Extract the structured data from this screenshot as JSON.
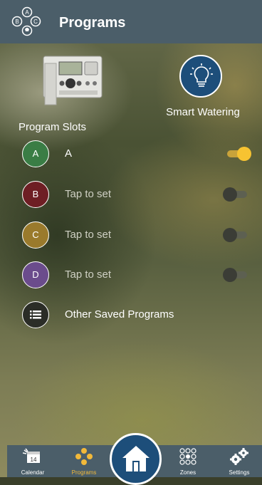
{
  "header": {
    "title": "Programs"
  },
  "smart_watering": {
    "label": "Smart Watering"
  },
  "slots": {
    "title": "Program Slots",
    "items": [
      {
        "letter": "A",
        "label": "A",
        "color": "#3a7d45",
        "enabled": true
      },
      {
        "letter": "B",
        "label": "Tap to set",
        "color": "#6e1e24",
        "enabled": false
      },
      {
        "letter": "C",
        "label": "Tap to set",
        "color": "#9a7a2c",
        "enabled": false
      },
      {
        "letter": "D",
        "label": "Tap to set",
        "color": "#6b4c8c",
        "enabled": false
      }
    ]
  },
  "other_programs": {
    "label": "Other Saved Programs"
  },
  "nav": {
    "items": [
      {
        "label": "Calendar",
        "icon": "calendar-icon",
        "day": "14"
      },
      {
        "label": "Programs",
        "icon": "programs-icon",
        "active": true
      },
      {
        "label": "Zones",
        "icon": "zones-icon"
      },
      {
        "label": "Settings",
        "icon": "settings-icon"
      }
    ],
    "home_icon": "home-icon"
  },
  "colors": {
    "header": "#4b5e69",
    "accent": "#f2b93a",
    "home": "#1d4e7a"
  }
}
